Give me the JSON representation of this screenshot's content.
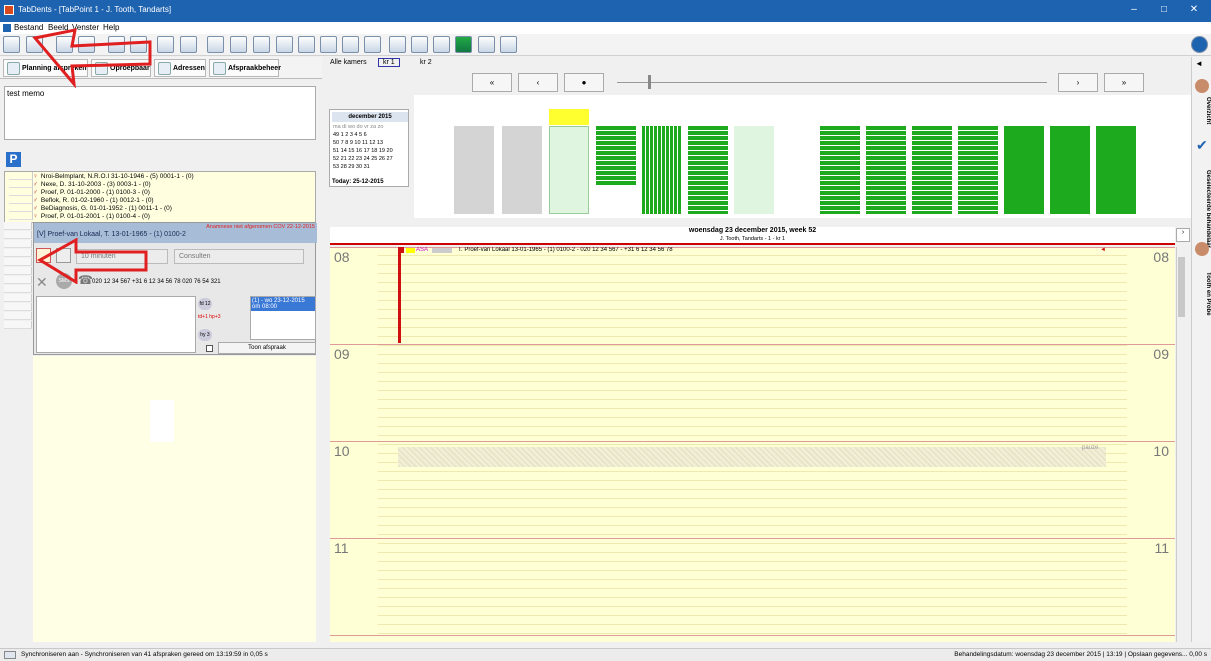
{
  "window": {
    "title": "TabDents - [TabPoint 1 - J. Tooth, Tandarts]",
    "controls": [
      "–",
      "□",
      "✕"
    ]
  },
  "menu": [
    "Bestand",
    "Beeld",
    "Venster",
    "Help"
  ],
  "tabs": [
    {
      "label": "Planning afspreken"
    },
    {
      "label": "Oproepbaar"
    },
    {
      "label": "Adressen"
    },
    {
      "label": "Afspraakbeheer"
    }
  ],
  "memo": "test memo",
  "patients": [
    "Nroi-Belmplant, N.R.O.I 31-10-1946 - (5) 0001-1 - (0)",
    "Nexe, D. 31-10-2003 - (3) 0003-1 - (0)",
    "Proef, P. 01-01-2000 - (1) 0100-3 - (0)",
    "Beflok, R. 01-02-1960 - (1) 0012-1 - (0)",
    "BeDiagnosis, G. 01-01-1952 - (1) 0011-1 - (0)",
    "Proef, P. 01-01-2001 - (1) 0100-4 - (0)"
  ],
  "patient_panel": {
    "name": "[V] Proef-van Lokaal, T. 13-01-1965 - (1) 0100-2",
    "warning": "Anamnese niet afgenomen  COV 22-12-2015",
    "duration": "10 minuten",
    "type": "Consulten",
    "phone": "020 12 34 567 +31 6 12 34 56 78 020 76 54 321",
    "appointment": "(1) - wo 23-12-2015 om 08:00",
    "show_button": "Toon afspraak",
    "badges": [
      "fd 12",
      "td+1 hp+3",
      "hy 3"
    ]
  },
  "rooms": {
    "all": "Alle kamers",
    "kr1": "kr 1",
    "kr2": "kr 2"
  },
  "nav": [
    "«",
    "‹",
    "●",
    "›",
    "»"
  ],
  "calendar": {
    "month": "december 2015",
    "days_header": "ma di wo do vr za zo",
    "rows": [
      "49   1  2  3  4  5  6",
      "50  7  8  9 10 11 12 13",
      "51 14 15 16 17 18 19 20",
      "52 21 22 23 24 25 26 27",
      "53 28 29 30 31"
    ],
    "today": "Today: 25-12-2015"
  },
  "day": {
    "date": "woensdag 23 december 2015, week 52",
    "practitioner": "J. Tooth, Tandarts - 1 - kr 1",
    "hours": [
      "08",
      "09",
      "10",
      "11"
    ],
    "appointment_text": "T. Proef-van Lokaal 13-01-1965 - (1) 0100-2 - 020 12 34 567 - +31 6 12 34 56 78",
    "asa": "ASA",
    "pauze": "pauze"
  },
  "right_tabs": [
    "Overzicht",
    "Geselecteerde behandelaar",
    "Tooth en Probe"
  ],
  "status": {
    "left": "Synchroniseren aan - Synchroniseren van 41 afspraken gereed om 13:19:59 in 0,05 s",
    "right": "Behandelingsdatum: woensdag 23 december 2015 | 13:19 | Opslaan gegevens... 0,00 s"
  },
  "colors": {
    "titlebar": "#1e63b0",
    "accent_red": "#cc0000",
    "appointment_green": "#22aa22",
    "day_background": "#ffffd6"
  }
}
